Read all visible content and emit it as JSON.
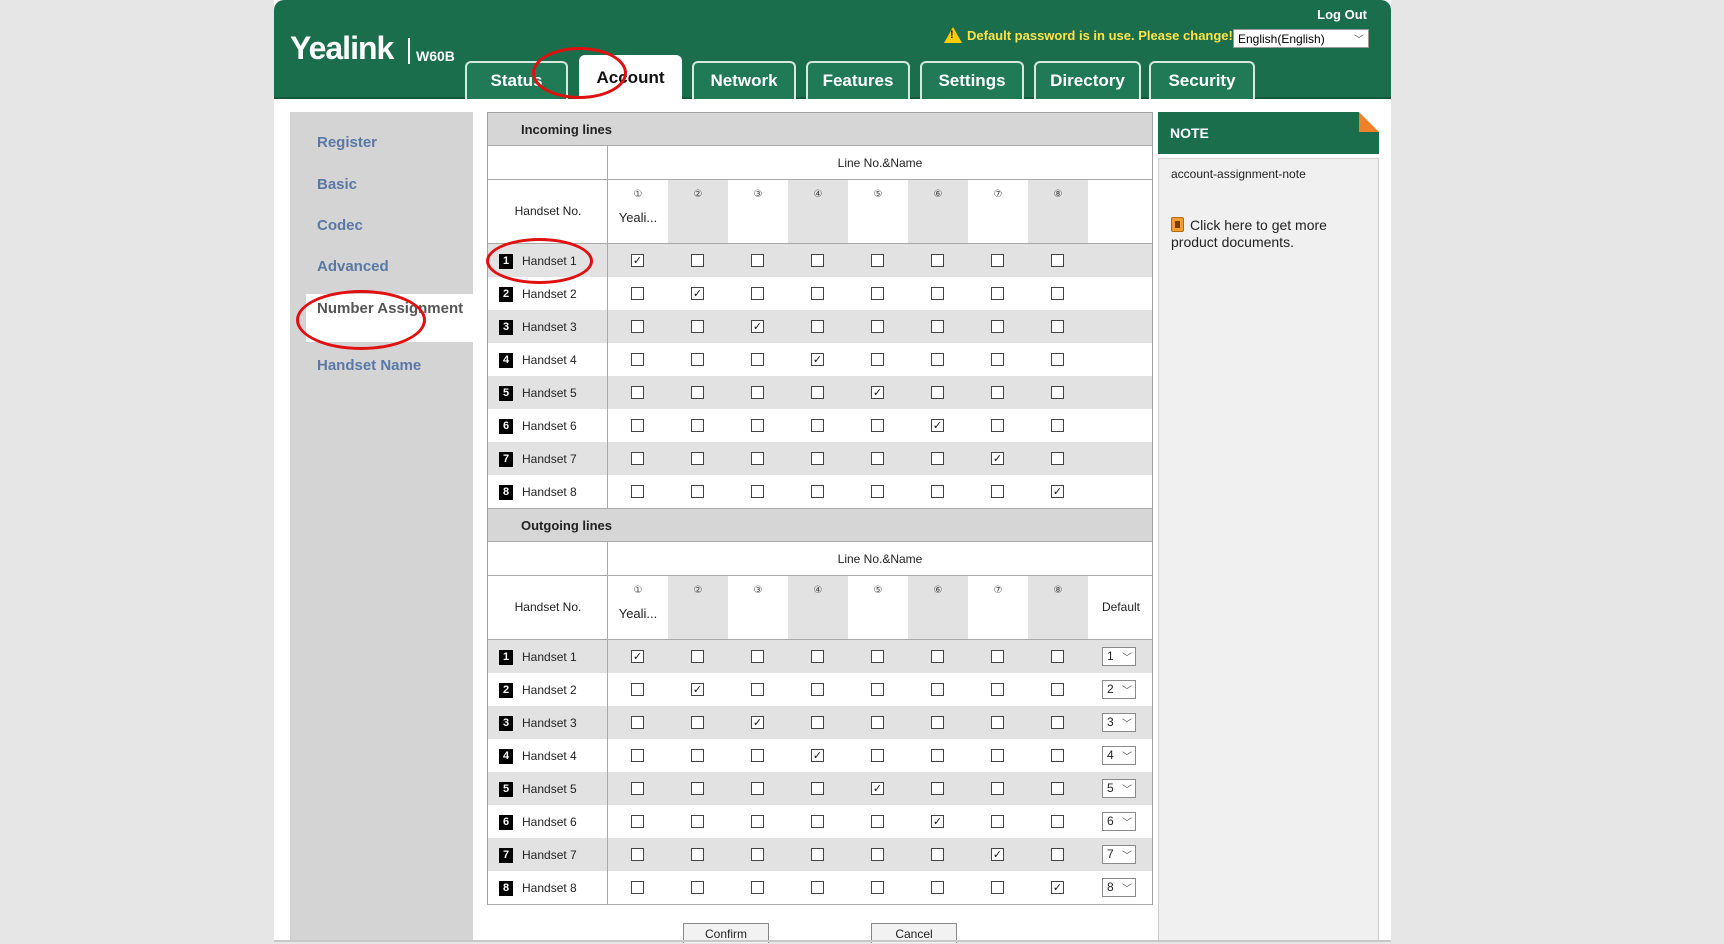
{
  "header": {
    "logo": "Yealink",
    "model": "W60B",
    "logout": "Log Out",
    "warning": "Default password is in use. Please change!",
    "language": "English(English)"
  },
  "tabs": [
    {
      "label": "Status"
    },
    {
      "label": "Account"
    },
    {
      "label": "Network"
    },
    {
      "label": "Features"
    },
    {
      "label": "Settings"
    },
    {
      "label": "Directory"
    },
    {
      "label": "Security"
    }
  ],
  "active_tab": "Account",
  "sidebar": {
    "items": [
      {
        "label": "Register"
      },
      {
        "label": "Basic"
      },
      {
        "label": "Codec"
      },
      {
        "label": "Advanced"
      },
      {
        "label": "Number Assignment"
      },
      {
        "label": "Handset Name"
      }
    ],
    "active": "Number Assignment"
  },
  "incoming": {
    "title": "Incoming lines",
    "line_header": "Line No.&Name",
    "handset_header": "Handset No.",
    "line_numbers": [
      "①",
      "②",
      "③",
      "④",
      "⑤",
      "⑥",
      "⑦",
      "⑧"
    ],
    "line_names": [
      "Yeali...",
      "",
      "",
      "",
      "",
      "",
      "",
      ""
    ],
    "rows": [
      {
        "num": "1",
        "name": "Handset 1",
        "checked": [
          1,
          0,
          0,
          0,
          0,
          0,
          0,
          0
        ]
      },
      {
        "num": "2",
        "name": "Handset 2",
        "checked": [
          0,
          1,
          0,
          0,
          0,
          0,
          0,
          0
        ]
      },
      {
        "num": "3",
        "name": "Handset 3",
        "checked": [
          0,
          0,
          1,
          0,
          0,
          0,
          0,
          0
        ]
      },
      {
        "num": "4",
        "name": "Handset 4",
        "checked": [
          0,
          0,
          0,
          1,
          0,
          0,
          0,
          0
        ]
      },
      {
        "num": "5",
        "name": "Handset 5",
        "checked": [
          0,
          0,
          0,
          0,
          1,
          0,
          0,
          0
        ]
      },
      {
        "num": "6",
        "name": "Handset 6",
        "checked": [
          0,
          0,
          0,
          0,
          0,
          1,
          0,
          0
        ]
      },
      {
        "num": "7",
        "name": "Handset 7",
        "checked": [
          0,
          0,
          0,
          0,
          0,
          0,
          1,
          0
        ]
      },
      {
        "num": "8",
        "name": "Handset 8",
        "checked": [
          0,
          0,
          0,
          0,
          0,
          0,
          0,
          1
        ]
      }
    ]
  },
  "outgoing": {
    "title": "Outgoing lines",
    "line_header": "Line No.&Name",
    "handset_header": "Handset No.",
    "default_header": "Default",
    "line_numbers": [
      "①",
      "②",
      "③",
      "④",
      "⑤",
      "⑥",
      "⑦",
      "⑧"
    ],
    "line_names": [
      "Yeali...",
      "",
      "",
      "",
      "",
      "",
      "",
      ""
    ],
    "rows": [
      {
        "num": "1",
        "name": "Handset 1",
        "checked": [
          1,
          0,
          0,
          0,
          0,
          0,
          0,
          0
        ],
        "default": "1"
      },
      {
        "num": "2",
        "name": "Handset 2",
        "checked": [
          0,
          1,
          0,
          0,
          0,
          0,
          0,
          0
        ],
        "default": "2"
      },
      {
        "num": "3",
        "name": "Handset 3",
        "checked": [
          0,
          0,
          1,
          0,
          0,
          0,
          0,
          0
        ],
        "default": "3"
      },
      {
        "num": "4",
        "name": "Handset 4",
        "checked": [
          0,
          0,
          0,
          1,
          0,
          0,
          0,
          0
        ],
        "default": "4"
      },
      {
        "num": "5",
        "name": "Handset 5",
        "checked": [
          0,
          0,
          0,
          0,
          1,
          0,
          0,
          0
        ],
        "default": "5"
      },
      {
        "num": "6",
        "name": "Handset 6",
        "checked": [
          0,
          0,
          0,
          0,
          0,
          1,
          0,
          0
        ],
        "default": "6"
      },
      {
        "num": "7",
        "name": "Handset 7",
        "checked": [
          0,
          0,
          0,
          0,
          0,
          0,
          1,
          0
        ],
        "default": "7"
      },
      {
        "num": "8",
        "name": "Handset 8",
        "checked": [
          0,
          0,
          0,
          0,
          0,
          0,
          0,
          1
        ],
        "default": "8"
      }
    ]
  },
  "buttons": {
    "confirm": "Confirm",
    "cancel": "Cancel"
  },
  "note": {
    "title": "NOTE",
    "text": "account-assignment-note",
    "link": "Click here to get more product documents."
  },
  "colors": {
    "header_green": "#1b6e4c",
    "annotation_red": "#e01010",
    "sidebar_link": "#5a78a6",
    "warning_yellow": "#ffe24a"
  }
}
